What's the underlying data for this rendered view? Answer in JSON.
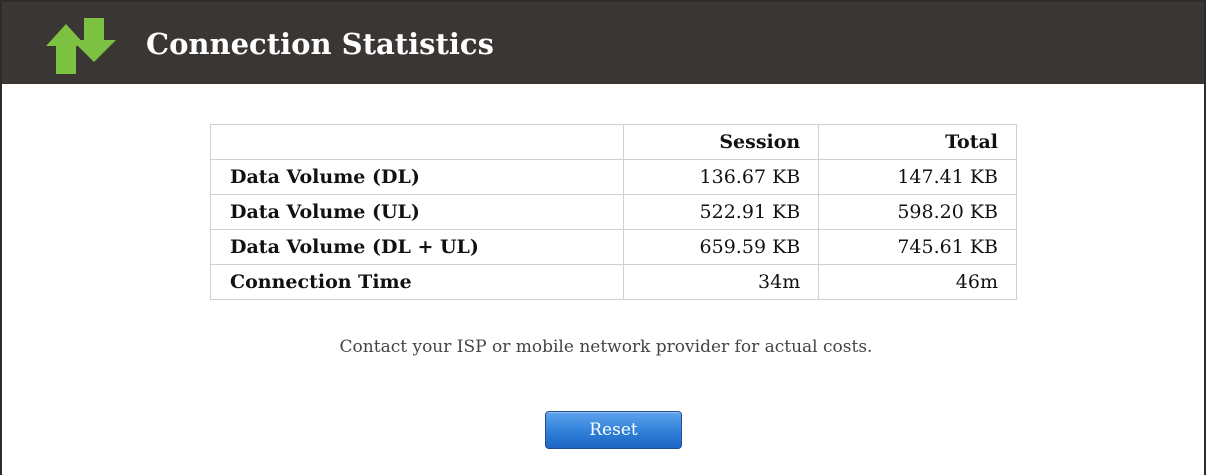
{
  "header": {
    "title": "Connection Statistics",
    "icon": "up-down-arrows-icon",
    "background": "#3a3634",
    "arrow_color": "#7cc142"
  },
  "stats_table": {
    "columns": [
      "",
      "Session",
      "Total"
    ],
    "rows": [
      {
        "label": "Data Volume (DL)",
        "session": "136.67 KB",
        "total": "147.41 KB"
      },
      {
        "label": "Data Volume (UL)",
        "session": "522.91 KB",
        "total": "598.20 KB"
      },
      {
        "label": "Data Volume (DL + UL)",
        "session": "659.59 KB",
        "total": "745.61 KB"
      },
      {
        "label": "Connection Time",
        "session": "34m",
        "total": "46m"
      }
    ]
  },
  "note": "Contact your ISP or mobile network provider for actual costs.",
  "actions": {
    "reset_label": "Reset",
    "button_color": "#2f7fd8"
  }
}
